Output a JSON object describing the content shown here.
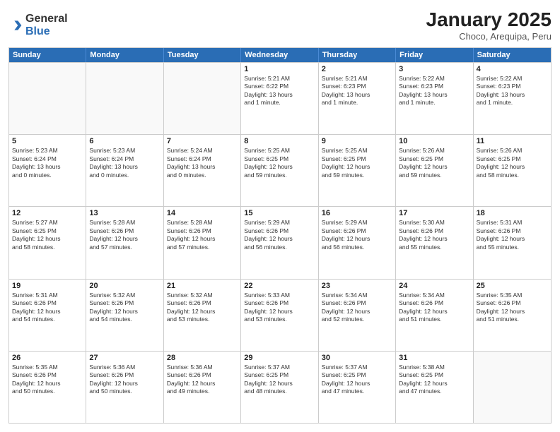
{
  "logo": {
    "general": "General",
    "blue": "Blue"
  },
  "header": {
    "month": "January 2025",
    "location": "Choco, Arequipa, Peru"
  },
  "weekdays": [
    "Sunday",
    "Monday",
    "Tuesday",
    "Wednesday",
    "Thursday",
    "Friday",
    "Saturday"
  ],
  "weeks": [
    [
      {
        "day": "",
        "info": ""
      },
      {
        "day": "",
        "info": ""
      },
      {
        "day": "",
        "info": ""
      },
      {
        "day": "1",
        "info": "Sunrise: 5:21 AM\nSunset: 6:22 PM\nDaylight: 13 hours\nand 1 minute."
      },
      {
        "day": "2",
        "info": "Sunrise: 5:21 AM\nSunset: 6:23 PM\nDaylight: 13 hours\nand 1 minute."
      },
      {
        "day": "3",
        "info": "Sunrise: 5:22 AM\nSunset: 6:23 PM\nDaylight: 13 hours\nand 1 minute."
      },
      {
        "day": "4",
        "info": "Sunrise: 5:22 AM\nSunset: 6:23 PM\nDaylight: 13 hours\nand 1 minute."
      }
    ],
    [
      {
        "day": "5",
        "info": "Sunrise: 5:23 AM\nSunset: 6:24 PM\nDaylight: 13 hours\nand 0 minutes."
      },
      {
        "day": "6",
        "info": "Sunrise: 5:23 AM\nSunset: 6:24 PM\nDaylight: 13 hours\nand 0 minutes."
      },
      {
        "day": "7",
        "info": "Sunrise: 5:24 AM\nSunset: 6:24 PM\nDaylight: 13 hours\nand 0 minutes."
      },
      {
        "day": "8",
        "info": "Sunrise: 5:25 AM\nSunset: 6:25 PM\nDaylight: 12 hours\nand 59 minutes."
      },
      {
        "day": "9",
        "info": "Sunrise: 5:25 AM\nSunset: 6:25 PM\nDaylight: 12 hours\nand 59 minutes."
      },
      {
        "day": "10",
        "info": "Sunrise: 5:26 AM\nSunset: 6:25 PM\nDaylight: 12 hours\nand 59 minutes."
      },
      {
        "day": "11",
        "info": "Sunrise: 5:26 AM\nSunset: 6:25 PM\nDaylight: 12 hours\nand 58 minutes."
      }
    ],
    [
      {
        "day": "12",
        "info": "Sunrise: 5:27 AM\nSunset: 6:25 PM\nDaylight: 12 hours\nand 58 minutes."
      },
      {
        "day": "13",
        "info": "Sunrise: 5:28 AM\nSunset: 6:26 PM\nDaylight: 12 hours\nand 57 minutes."
      },
      {
        "day": "14",
        "info": "Sunrise: 5:28 AM\nSunset: 6:26 PM\nDaylight: 12 hours\nand 57 minutes."
      },
      {
        "day": "15",
        "info": "Sunrise: 5:29 AM\nSunset: 6:26 PM\nDaylight: 12 hours\nand 56 minutes."
      },
      {
        "day": "16",
        "info": "Sunrise: 5:29 AM\nSunset: 6:26 PM\nDaylight: 12 hours\nand 56 minutes."
      },
      {
        "day": "17",
        "info": "Sunrise: 5:30 AM\nSunset: 6:26 PM\nDaylight: 12 hours\nand 55 minutes."
      },
      {
        "day": "18",
        "info": "Sunrise: 5:31 AM\nSunset: 6:26 PM\nDaylight: 12 hours\nand 55 minutes."
      }
    ],
    [
      {
        "day": "19",
        "info": "Sunrise: 5:31 AM\nSunset: 6:26 PM\nDaylight: 12 hours\nand 54 minutes."
      },
      {
        "day": "20",
        "info": "Sunrise: 5:32 AM\nSunset: 6:26 PM\nDaylight: 12 hours\nand 54 minutes."
      },
      {
        "day": "21",
        "info": "Sunrise: 5:32 AM\nSunset: 6:26 PM\nDaylight: 12 hours\nand 53 minutes."
      },
      {
        "day": "22",
        "info": "Sunrise: 5:33 AM\nSunset: 6:26 PM\nDaylight: 12 hours\nand 53 minutes."
      },
      {
        "day": "23",
        "info": "Sunrise: 5:34 AM\nSunset: 6:26 PM\nDaylight: 12 hours\nand 52 minutes."
      },
      {
        "day": "24",
        "info": "Sunrise: 5:34 AM\nSunset: 6:26 PM\nDaylight: 12 hours\nand 51 minutes."
      },
      {
        "day": "25",
        "info": "Sunrise: 5:35 AM\nSunset: 6:26 PM\nDaylight: 12 hours\nand 51 minutes."
      }
    ],
    [
      {
        "day": "26",
        "info": "Sunrise: 5:35 AM\nSunset: 6:26 PM\nDaylight: 12 hours\nand 50 minutes."
      },
      {
        "day": "27",
        "info": "Sunrise: 5:36 AM\nSunset: 6:26 PM\nDaylight: 12 hours\nand 50 minutes."
      },
      {
        "day": "28",
        "info": "Sunrise: 5:36 AM\nSunset: 6:26 PM\nDaylight: 12 hours\nand 49 minutes."
      },
      {
        "day": "29",
        "info": "Sunrise: 5:37 AM\nSunset: 6:25 PM\nDaylight: 12 hours\nand 48 minutes."
      },
      {
        "day": "30",
        "info": "Sunrise: 5:37 AM\nSunset: 6:25 PM\nDaylight: 12 hours\nand 47 minutes."
      },
      {
        "day": "31",
        "info": "Sunrise: 5:38 AM\nSunset: 6:25 PM\nDaylight: 12 hours\nand 47 minutes."
      },
      {
        "day": "",
        "info": ""
      }
    ]
  ]
}
